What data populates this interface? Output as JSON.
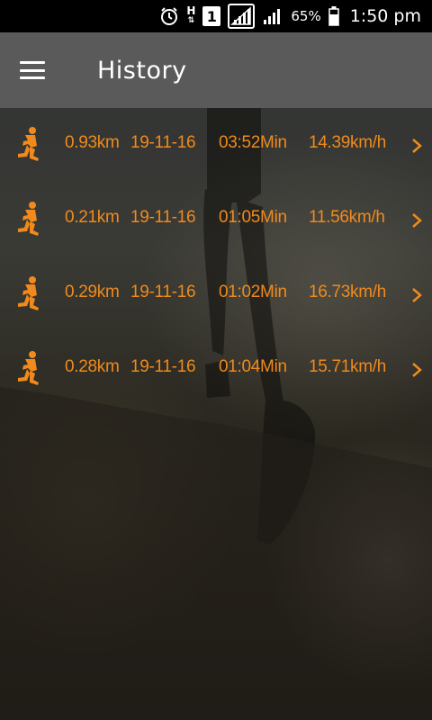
{
  "status_bar": {
    "icons": [
      "alarm-icon",
      "network-h-icon",
      "sim-1-icon",
      "signal-icon",
      "signal-icon",
      "battery-icon"
    ],
    "h_label": "H",
    "sim_label": "1",
    "battery": "65%",
    "time": "1:50 pm"
  },
  "app_bar": {
    "menu_icon": "hamburger-menu-icon",
    "title": "History"
  },
  "colors": {
    "accent": "#f08a1c",
    "app_bar": "#5a5a5a",
    "status_bar": "#000000"
  },
  "history": [
    {
      "distance": "0.93km",
      "date": "19-11-16",
      "duration": "03:52Min",
      "speed": "14.39km/h",
      "icon": "runner-icon",
      "chevron": ">"
    },
    {
      "distance": "0.21km",
      "date": "19-11-16",
      "duration": "01:05Min",
      "speed": "11.56km/h",
      "icon": "runner-icon",
      "chevron": ">"
    },
    {
      "distance": "0.29km",
      "date": "19-11-16",
      "duration": "01:02Min",
      "speed": "16.73km/h",
      "icon": "runner-icon",
      "chevron": ">"
    },
    {
      "distance": "0.28km",
      "date": "19-11-16",
      "duration": "01:04Min",
      "speed": "15.71km/h",
      "icon": "runner-icon",
      "chevron": ">"
    }
  ]
}
